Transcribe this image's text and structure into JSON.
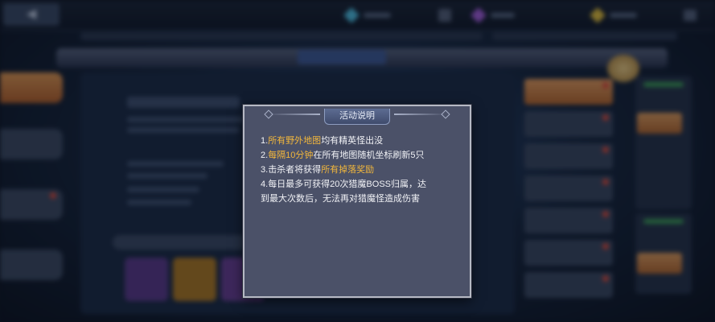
{
  "colors": {
    "dialog_bg": "#4b5168",
    "highlight": "#f2b73c",
    "text": "#f1f2f6"
  },
  "background": {
    "icons": [
      "back-arrow-icon",
      "crystal-icon",
      "purple-gem-icon",
      "gold-gem-icon",
      "mail-icon"
    ]
  },
  "dialog": {
    "title": "活动说明",
    "lines": [
      {
        "num": "1.",
        "highlight": "所有野外地图",
        "text": "均有精英怪出没",
        "rest": ""
      },
      {
        "num": "2.",
        "highlight": "每隔10分钟",
        "text": "在所有地图随机坐标刷新5只",
        "rest": ""
      },
      {
        "num": "3.",
        "pre": "击杀者将获得",
        "highlight": "所有掉落奖励"
      },
      {
        "num": "4.",
        "text": "每日最多可获得20次猎魔BOSS归属，达",
        "cont": "到最大次数后，无法再对猎魔怪造成伤害"
      }
    ]
  }
}
